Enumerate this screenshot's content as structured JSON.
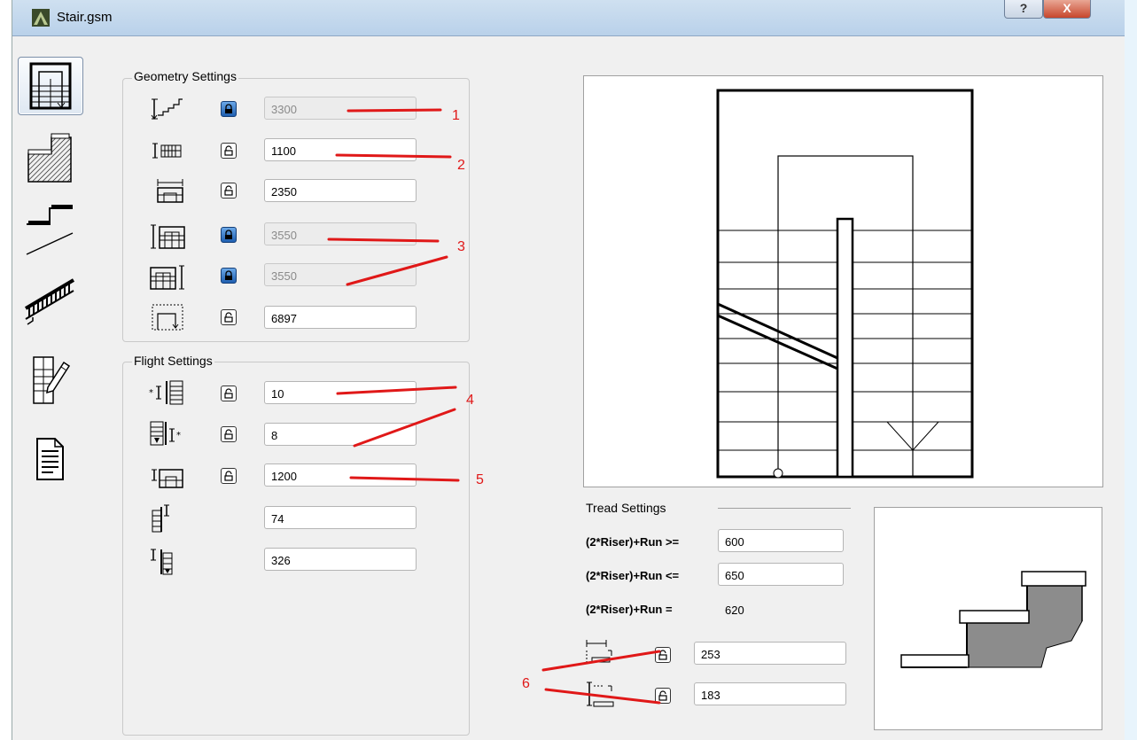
{
  "window": {
    "title": "Stair.gsm",
    "help_label": "?",
    "close_label": "X"
  },
  "tabs": [
    {
      "name": "tab-geometry",
      "icon": "stair-plan-icon",
      "active": true
    },
    {
      "name": "tab-structure",
      "icon": "stair-structure-icon",
      "active": false
    },
    {
      "name": "tab-tread",
      "icon": "stair-tread-icon",
      "active": false
    },
    {
      "name": "tab-railing",
      "icon": "stair-railing-icon",
      "active": false
    },
    {
      "name": "tab-symbol",
      "icon": "symbol-pencil-icon",
      "active": false
    },
    {
      "name": "tab-listing",
      "icon": "document-icon",
      "active": false
    }
  ],
  "geometry": {
    "title": "Geometry Settings",
    "rows": [
      {
        "icon": "stair-height-icon",
        "locked": true,
        "value": "3300",
        "readonly": true
      },
      {
        "icon": "stair-width-icon",
        "locked": false,
        "value": "1100",
        "readonly": false
      },
      {
        "icon": "stair-span-icon",
        "locked": false,
        "value": "2350",
        "readonly": false
      },
      {
        "icon": "left-flight-length-icon",
        "locked": true,
        "value": "3550",
        "readonly": true
      },
      {
        "icon": "right-flight-length-icon",
        "locked": true,
        "value": "3550",
        "readonly": true
      },
      {
        "icon": "walking-line-length-icon",
        "locked": false,
        "value": "6897",
        "readonly": false
      }
    ]
  },
  "flight": {
    "title": "Flight Settings",
    "rows": [
      {
        "icon": "first-flight-risers-icon",
        "locked": false,
        "value": "10"
      },
      {
        "icon": "second-flight-risers-icon",
        "locked": false,
        "value": "8"
      },
      {
        "icon": "landing-length-icon",
        "locked": false,
        "value": "1200"
      },
      {
        "icon": "riser-offset-top-icon",
        "value": "74"
      },
      {
        "icon": "riser-offset-bottom-icon",
        "value": "326"
      }
    ]
  },
  "tread": {
    "title": "Tread Settings",
    "min_label": "(2*Riser)+Run >=",
    "min_value": "600",
    "max_label": "(2*Riser)+Run <=",
    "max_value": "650",
    "cur_label": "(2*Riser)+Run =",
    "cur_value": "620",
    "tread_depth": {
      "icon": "tread-depth-icon",
      "locked": false,
      "value": "253"
    },
    "riser_height": {
      "icon": "riser-height-icon",
      "locked": false,
      "value": "183"
    }
  },
  "annotations": [
    "1",
    "2",
    "3",
    "4",
    "5",
    "6"
  ],
  "colors": {
    "annotation": "#e01818",
    "lock_on": "#1f5fb0",
    "tread_fill": "#8c8c8c"
  }
}
